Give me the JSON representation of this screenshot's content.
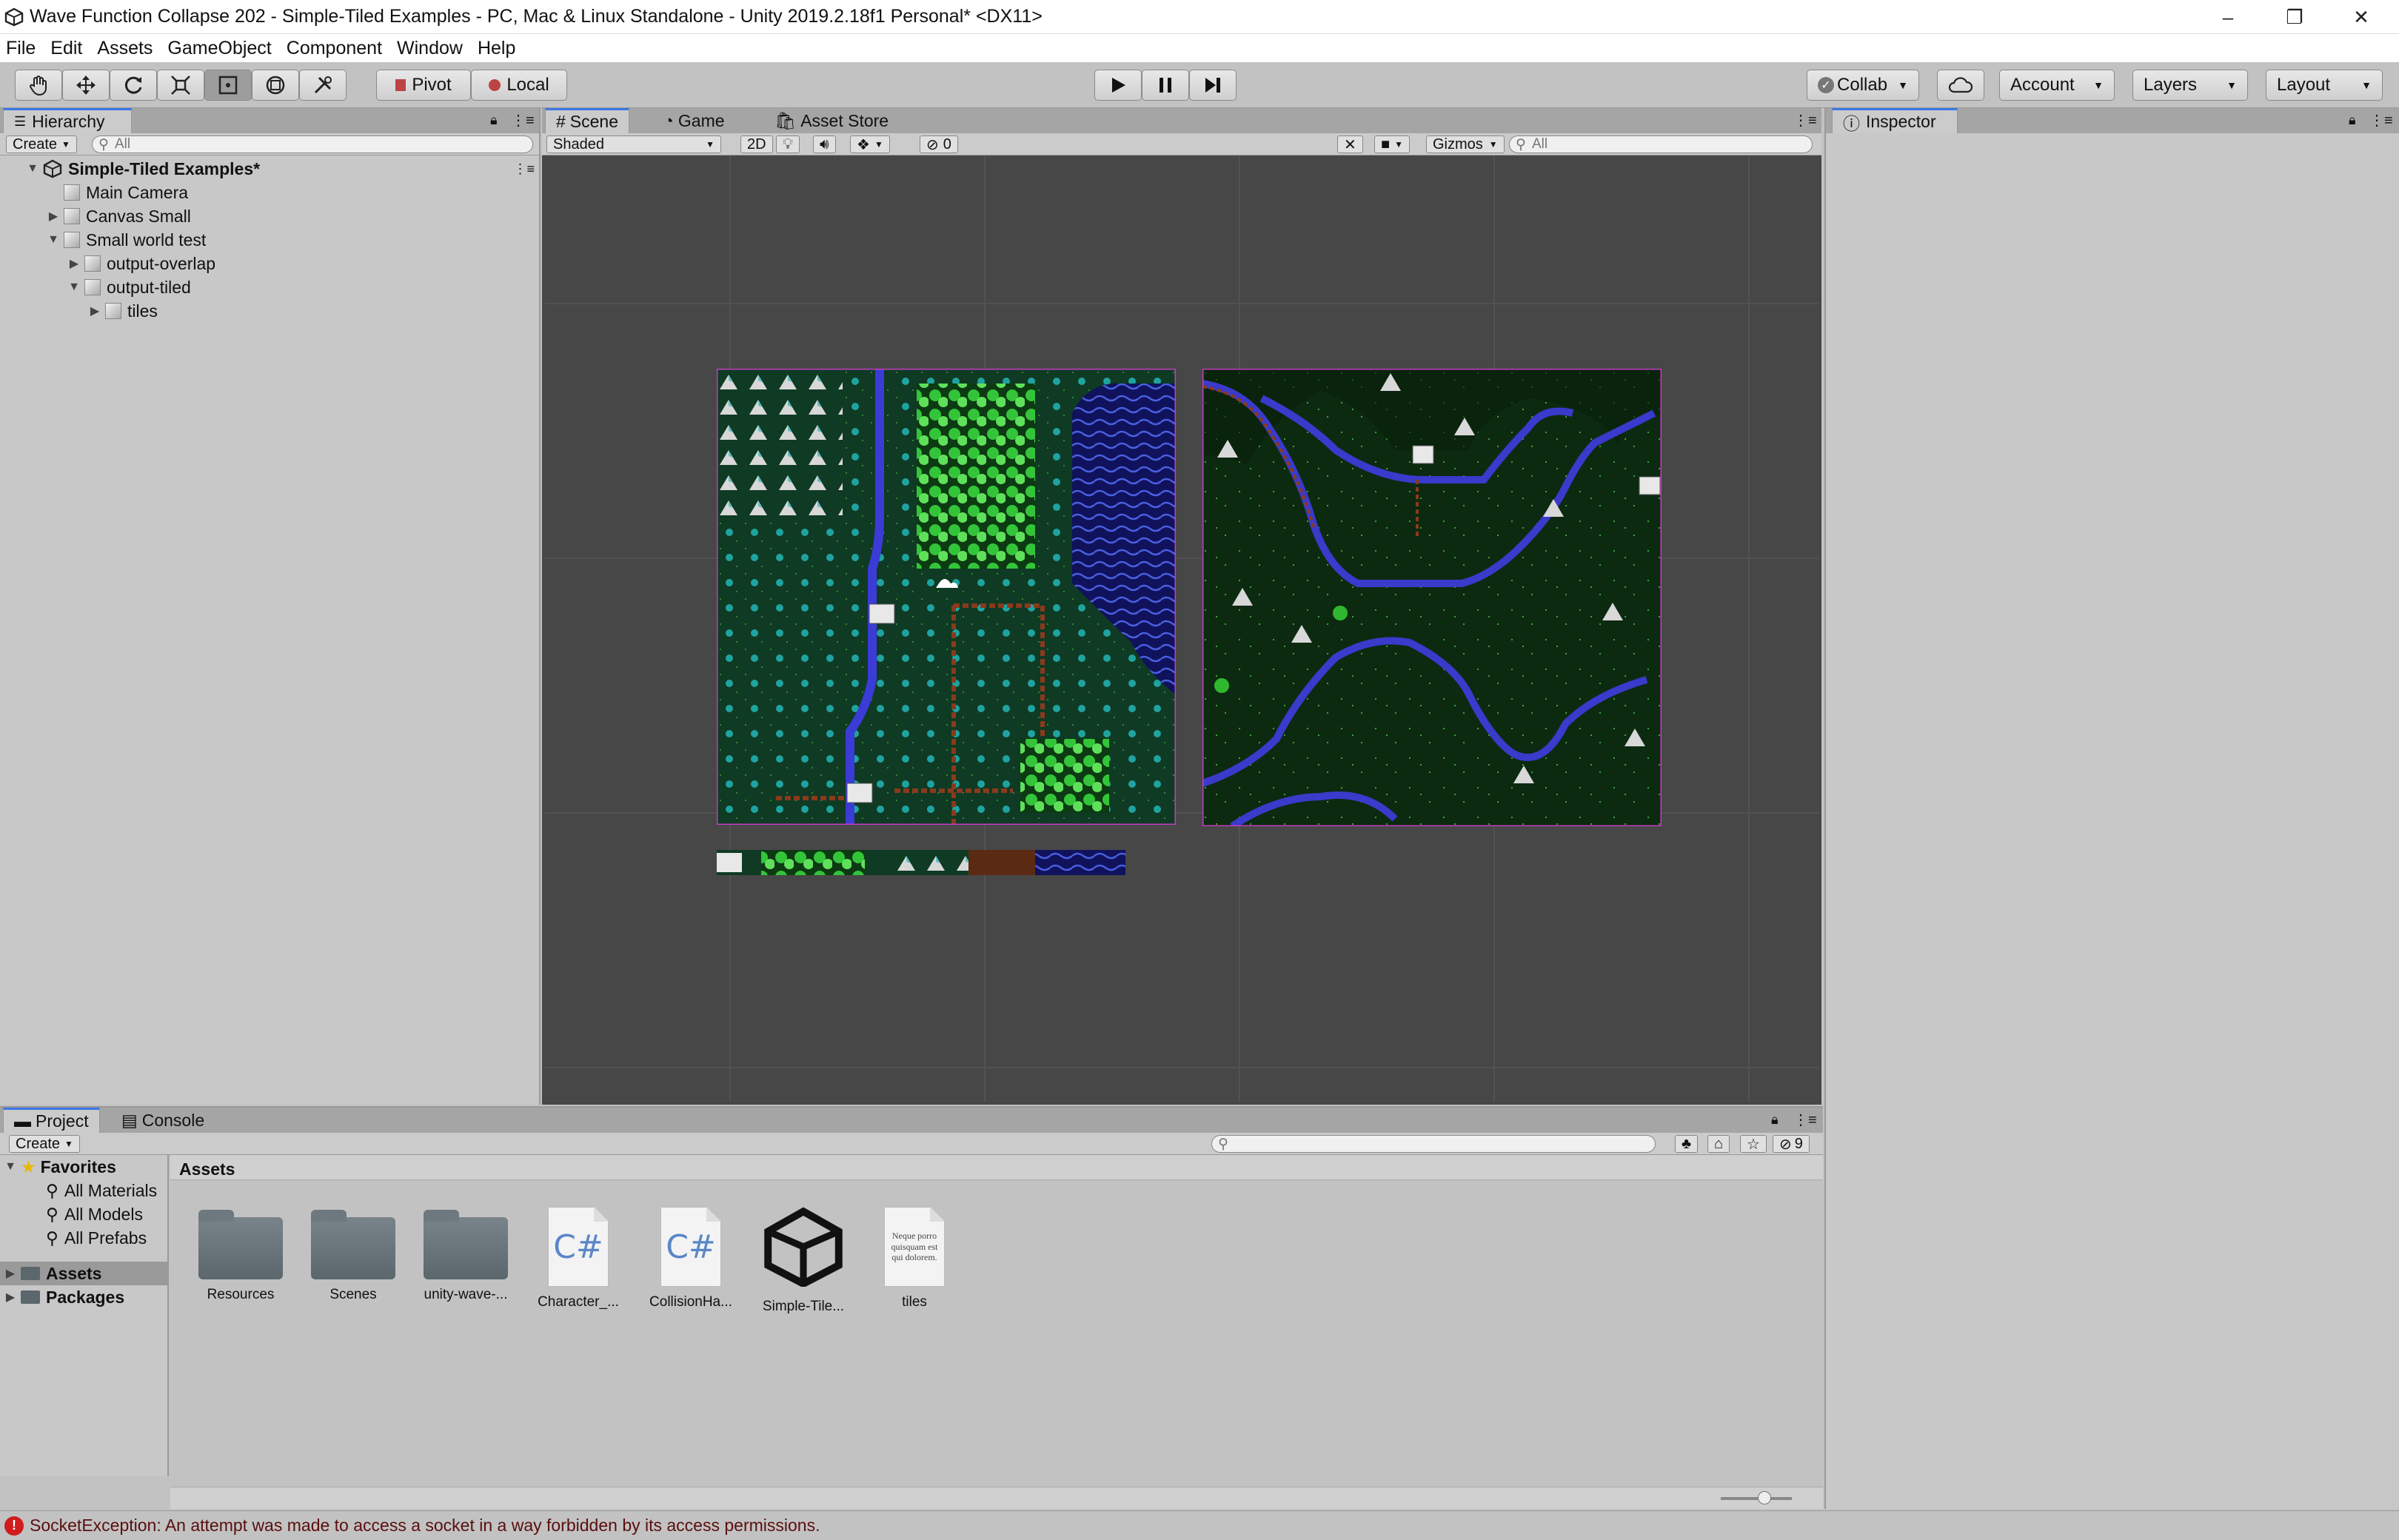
{
  "window": {
    "title": "Wave Function Collapse 202 - Simple-Tiled Examples - PC, Mac & Linux Standalone - Unity 2019.2.18f1 Personal* <DX11>",
    "min": "–",
    "restore": "❐",
    "close": "✕"
  },
  "menu": [
    "File",
    "Edit",
    "Assets",
    "GameObject",
    "Component",
    "Window",
    "Help"
  ],
  "toolbar": {
    "pivot": "Pivot",
    "local": "Local",
    "collab": "Collab",
    "account": "Account",
    "layers": "Layers",
    "layout": "Layout"
  },
  "hierarchy": {
    "tab": "Hierarchy",
    "create": "Create",
    "search_placeholder": "All",
    "scene": "Simple-Tiled Examples*",
    "items": [
      {
        "label": "Main Camera"
      },
      {
        "label": "Canvas Small"
      },
      {
        "label": "Small world test"
      },
      {
        "label": "output-overlap"
      },
      {
        "label": "output-tiled"
      },
      {
        "label": "tiles"
      }
    ]
  },
  "scene": {
    "tabs": [
      "Scene",
      "Game",
      "Asset Store"
    ],
    "shading": "Shaded",
    "mode2d": "2D",
    "hidden_count": "0",
    "gizmos": "Gizmos",
    "search_placeholder": "All"
  },
  "inspector": {
    "tab": "Inspector"
  },
  "project": {
    "tabs": [
      "Project",
      "Console"
    ],
    "create": "Create",
    "count": "9",
    "favorites": {
      "label": "Favorites",
      "items": [
        "All Materials",
        "All Models",
        "All Prefabs"
      ]
    },
    "roots": [
      "Assets",
      "Packages"
    ],
    "breadcrumb": "Assets",
    "assets": [
      {
        "label": "Resources",
        "kind": "folder"
      },
      {
        "label": "Scenes",
        "kind": "folder"
      },
      {
        "label": "unity-wave-...",
        "kind": "folder"
      },
      {
        "label": "Character_...",
        "kind": "cs"
      },
      {
        "label": "CollisionHa...",
        "kind": "cs"
      },
      {
        "label": "Simple-Tile...",
        "kind": "unity"
      },
      {
        "label": "tiles",
        "kind": "text"
      }
    ],
    "text_preview": "Neque porro quisquam est qui dolorem."
  },
  "status": {
    "message": "SocketException: An attempt was made to access a socket in a way forbidden by its access permissions."
  }
}
